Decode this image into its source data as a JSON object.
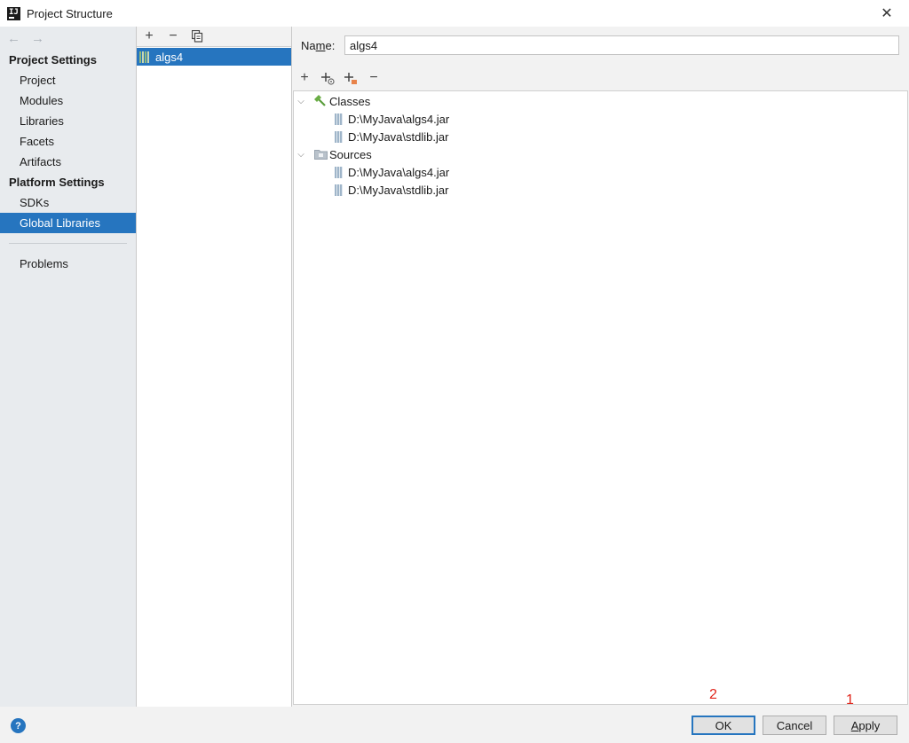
{
  "window": {
    "title": "Project Structure",
    "close_glyph": "✕"
  },
  "nav": {
    "back": "←",
    "forward": "→"
  },
  "sidebar": {
    "project_settings_heading": "Project Settings",
    "project_items": [
      "Project",
      "Modules",
      "Libraries",
      "Facets",
      "Artifacts"
    ],
    "platform_settings_heading": "Platform Settings",
    "platform_items": [
      "SDKs",
      "Global Libraries"
    ],
    "selected": "Global Libraries",
    "problems": "Problems"
  },
  "library_list": {
    "toolbar": {
      "add": "+",
      "remove": "−",
      "copy": "copy-icon"
    },
    "items": [
      "algs4"
    ],
    "selected": "algs4"
  },
  "details": {
    "name_label_prefix": "Na",
    "name_label_underlined": "m",
    "name_label_suffix": "e:",
    "name_value": "algs4",
    "tree_toolbar": {
      "add": "+",
      "remove": "−"
    },
    "tree": {
      "classes_label": "Classes",
      "classes": [
        "D:\\MyJava\\algs4.jar",
        "D:\\MyJava\\stdlib.jar"
      ],
      "sources_label": "Sources",
      "sources": [
        "D:\\MyJava\\algs4.jar",
        "D:\\MyJava\\stdlib.jar"
      ]
    }
  },
  "buttons": {
    "ok": "OK",
    "cancel": "Cancel",
    "apply_underlined": "A",
    "apply_rest": "pply",
    "help": "?"
  },
  "annotations": {
    "ok_number": "2",
    "apply_number": "1"
  },
  "colors": {
    "selection": "#2675bf",
    "sidebar_bg": "#e8ebee",
    "annotation": "#e0241a"
  }
}
